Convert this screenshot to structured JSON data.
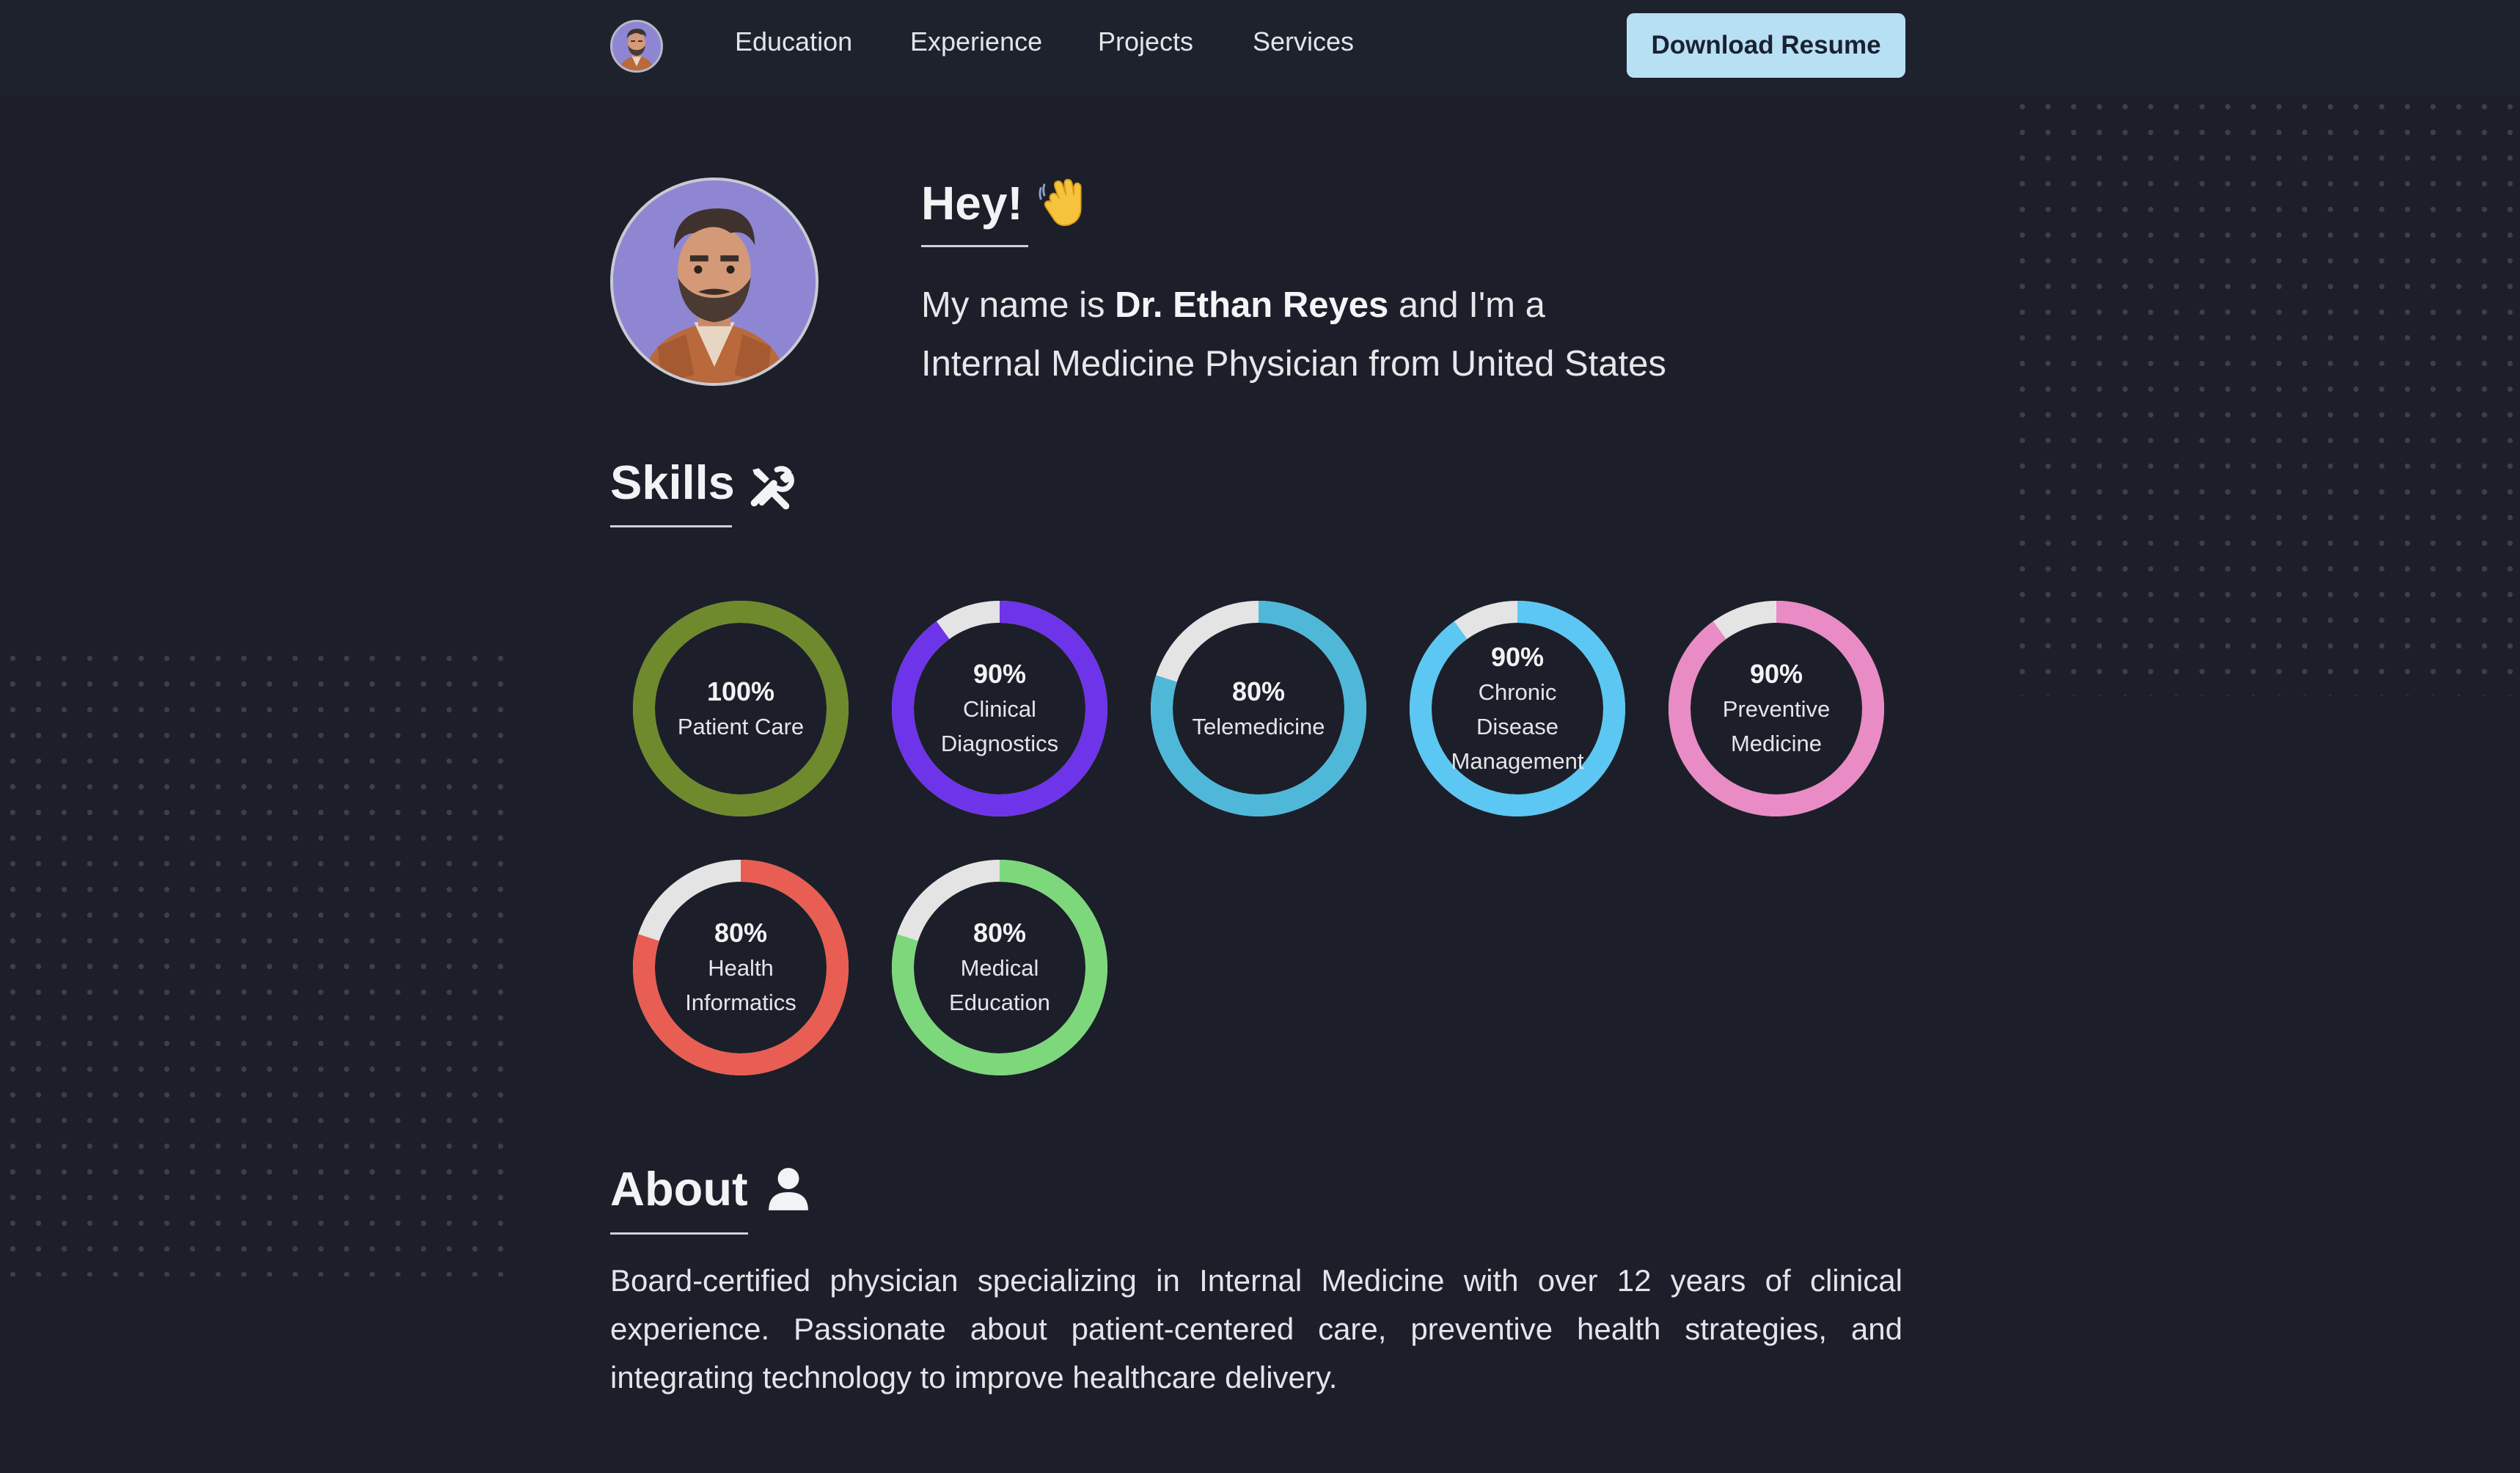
{
  "nav": {
    "links": [
      "Education",
      "Experience",
      "Projects",
      "Services"
    ],
    "resume_label": "Download Resume"
  },
  "hero": {
    "greeting": "Hey!",
    "greeting_icon": "waving-hand-icon",
    "intro_prefix": "My name is ",
    "name": "Dr. Ethan Reyes",
    "intro_suffix": " and I'm a",
    "intro_line2": "Internal Medicine Physician from United States"
  },
  "skills": {
    "title": "Skills",
    "title_icon": "tools-icon",
    "track_color": "#e4e4e4",
    "items": [
      {
        "percent_label": "100%",
        "name": "Patient Care",
        "value": 100,
        "color": "#6e8a2c"
      },
      {
        "percent_label": "90%",
        "name": "Clinical Diagnostics",
        "value": 90,
        "color": "#6e34e9"
      },
      {
        "percent_label": "80%",
        "name": "Telemedicine",
        "value": 80,
        "color": "#4fb8d8"
      },
      {
        "percent_label": "90%",
        "name": "Chronic Disease Management",
        "value": 90,
        "color": "#5cc7f2"
      },
      {
        "percent_label": "90%",
        "name": "Preventive Medicine",
        "value": 90,
        "color": "#e98bc4"
      },
      {
        "percent_label": "80%",
        "name": "Health Informatics",
        "value": 80,
        "color": "#e85e52"
      },
      {
        "percent_label": "80%",
        "name": "Medical Education",
        "value": 80,
        "color": "#7dd87c"
      }
    ]
  },
  "about": {
    "title": "About",
    "title_icon": "user-icon",
    "text": "Board-certified physician specializing in Internal Medicine with over 12 years of clinical experience. Passionate about patient-centered care, preventive health strategies, and integrating technology to improve healthcare delivery."
  }
}
